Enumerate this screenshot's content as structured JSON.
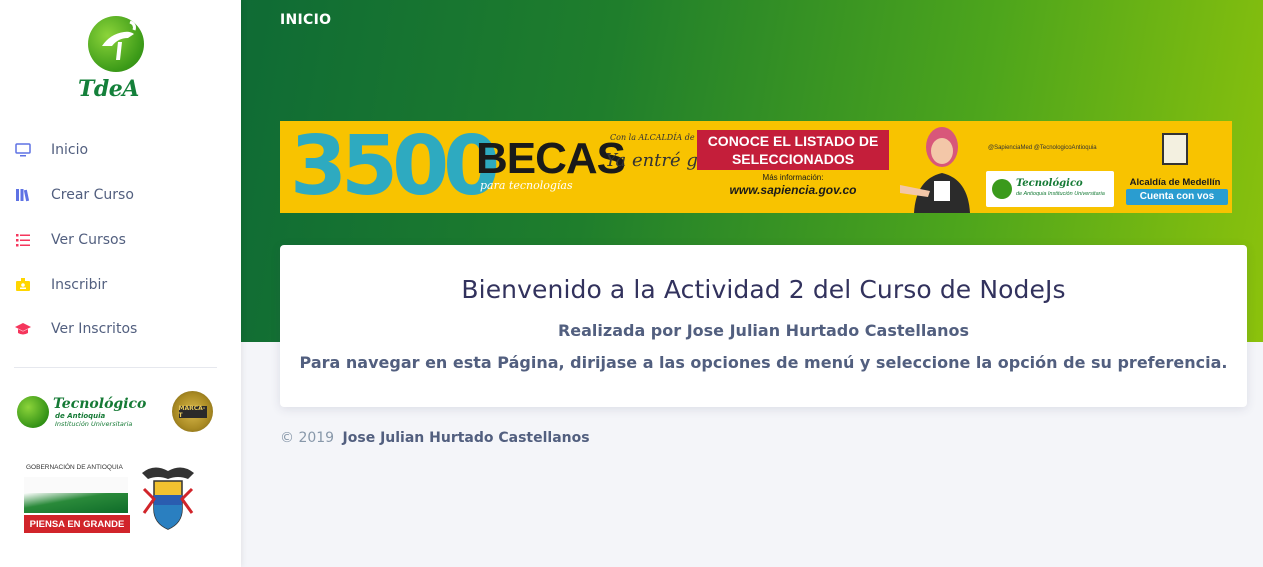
{
  "brand": {
    "name": "TdeA"
  },
  "sidebar": {
    "items": [
      {
        "label": "Inicio",
        "icon": "monitor-icon",
        "color": "#5e72e4"
      },
      {
        "label": "Crear Curso",
        "icon": "books-icon",
        "color": "#5e72e4"
      },
      {
        "label": "Ver Cursos",
        "icon": "list-icon",
        "color": "#f5365c"
      },
      {
        "label": "Inscribir",
        "icon": "badge-icon",
        "color": "#ffd600"
      },
      {
        "label": "Ver Inscritos",
        "icon": "graduation-cap-icon",
        "color": "#f5365c"
      }
    ]
  },
  "logos": {
    "tecnologico": {
      "name": "Tecnológico",
      "line1": "de Antioquia",
      "line2": "Institución Universitaria",
      "badge": "MARCA-T"
    },
    "gobernacion": {
      "title": "GOBERNACIÓN DE ANTIOQUIA",
      "slogan": "PIENSA EN GRANDE"
    }
  },
  "header": {
    "title": "INICIO"
  },
  "banner": {
    "number": "3500",
    "becas": "BECAS",
    "para": "para tecnologías",
    "ya_small": "Con la ALCALDÍA de MEDELLÍN",
    "ya_entre": "Ya entré ganando",
    "cta": "CONOCE EL LISTADO DE SELECCIONADOS",
    "mas_info": "Más información:",
    "url": "www.sapiencia.gov.co",
    "social": "@SapienciaMed  @TecnologicoAntioquia",
    "tec_name": "Tecnológico",
    "tec_sub": "de Antioquia Institución Universitaria",
    "alcaldia": "Alcaldía de Medellín",
    "alcaldia_slogan": "Cuenta con vos"
  },
  "card": {
    "title": "Bienvenido a la Actividad 2 del Curso de NodeJs",
    "author": "Realizada por Jose Julian Hurtado Castellanos",
    "instructions": "Para navegar en esta Página, dirijase a las opciones de menú y seleccione la opción de su preferencia."
  },
  "footer": {
    "copyright": "© 2019",
    "author": "Jose Julian Hurtado Castellanos"
  }
}
